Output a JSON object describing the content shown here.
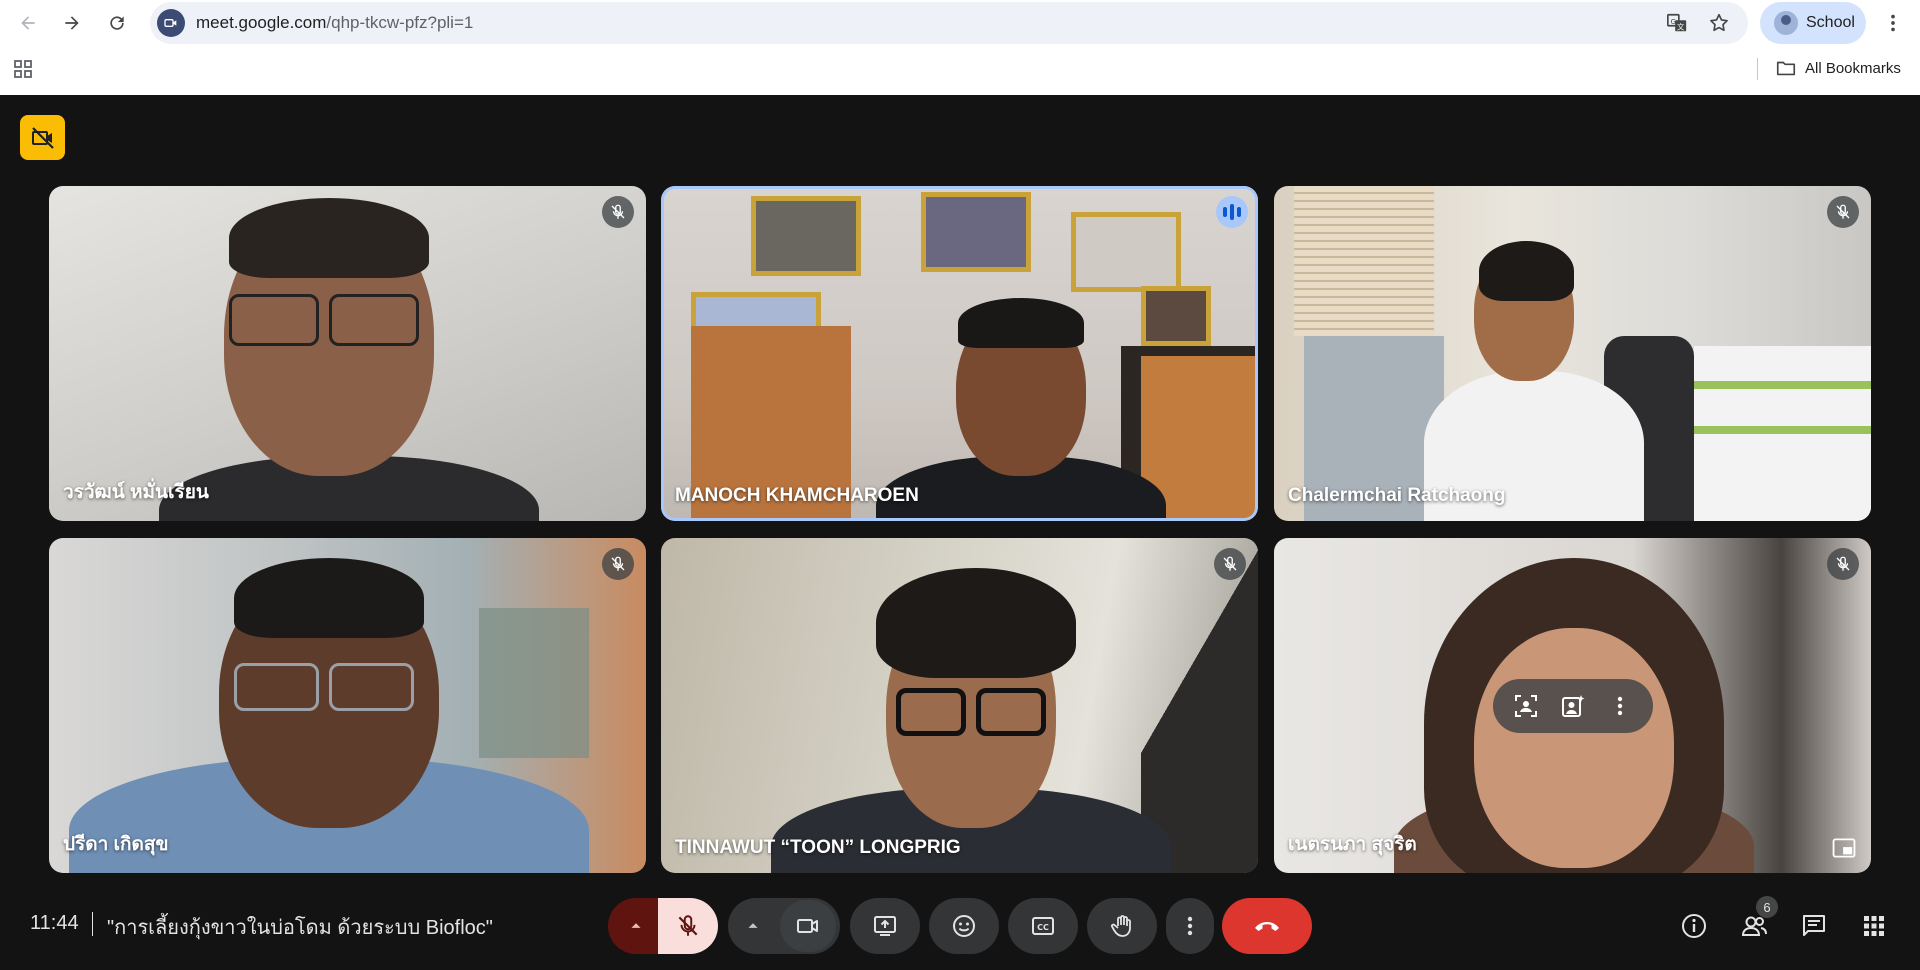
{
  "browser": {
    "url_host": "meet.google.com",
    "url_path": "/qhp-tkcw-pfz?pli=1",
    "profile_label": "School",
    "bookmarks_label": "All Bookmarks",
    "nav_icons": [
      "back-icon",
      "forward-icon",
      "reload-icon"
    ],
    "omnibox_icons": [
      "translate-icon",
      "star-icon"
    ]
  },
  "meet": {
    "camera_off_badge_color": "#fbbc04",
    "participants": [
      {
        "name": "วรวัฒน์ หมั่นเรียน",
        "muted": true,
        "speaking": false
      },
      {
        "name": "MANOCH KHAMCHAROEN",
        "muted": false,
        "speaking": true
      },
      {
        "name": "Chalermchai Ratchaong",
        "muted": true,
        "speaking": false
      },
      {
        "name": "ปรีดา เกิดสุข",
        "muted": true,
        "speaking": false
      },
      {
        "name": "TINNAWUT “TOON” LONGPRIG",
        "muted": true,
        "speaking": false
      },
      {
        "name": "เนตรนภา สุจริต",
        "muted": true,
        "speaking": false
      }
    ],
    "hover_actions": [
      "frame-person-icon",
      "add-effects-icon",
      "more-options-icon"
    ],
    "colors": {
      "speaking_border": "#a8c7fa",
      "end_call": "#dc362e",
      "mic_off_bg": "#f9dedc"
    }
  },
  "bottom_bar": {
    "time": "11:44",
    "title": "\"การเลี้ยงกุ้งขาวในบ่อโดม ด้วยระบบ Biofloc\"",
    "participant_count": "6",
    "controls": [
      "mic-options-icon",
      "mic-off-icon",
      "camera-options-icon",
      "camera-icon",
      "present-icon",
      "emoji-icon",
      "captions-icon",
      "raise-hand-icon",
      "more-icon",
      "end-call-icon"
    ],
    "side_controls": [
      "info-icon",
      "people-icon",
      "chat-icon",
      "activities-icon"
    ]
  }
}
